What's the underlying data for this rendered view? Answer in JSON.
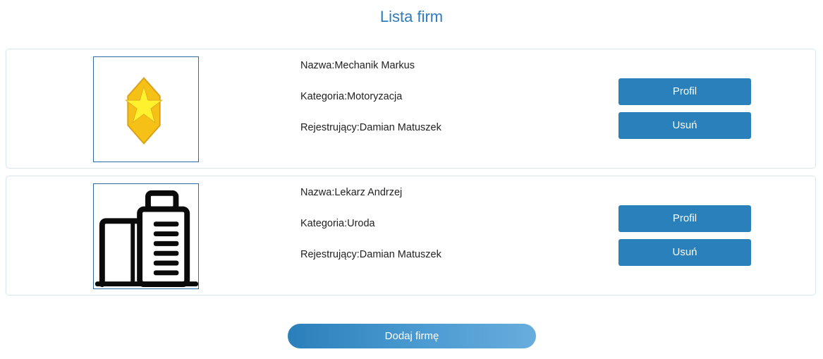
{
  "page": {
    "title": "Lista firm"
  },
  "companies": [
    {
      "name_label": "Nazwa:Mechanik Markus",
      "category_label": "Kategoria:Motoryzacja",
      "registrant_label": "Rejestrujący:Damian Matuszek",
      "logo_icon": "gold-star-badge-icon",
      "profile_button": "Profil",
      "delete_button": "Usuń"
    },
    {
      "name_label": "Nazwa:Lekarz Andrzej",
      "category_label": "Kategoria:Uroda",
      "registrant_label": "Rejestrujący:Damian Matuszek",
      "logo_icon": "office-building-icon",
      "profile_button": "Profil",
      "delete_button": "Usuń"
    }
  ],
  "actions": {
    "add_company_button": "Dodaj firmę"
  },
  "colors": {
    "accent": "#2980ba",
    "title": "#2e7bbd",
    "card_border": "#d6e6f3"
  }
}
